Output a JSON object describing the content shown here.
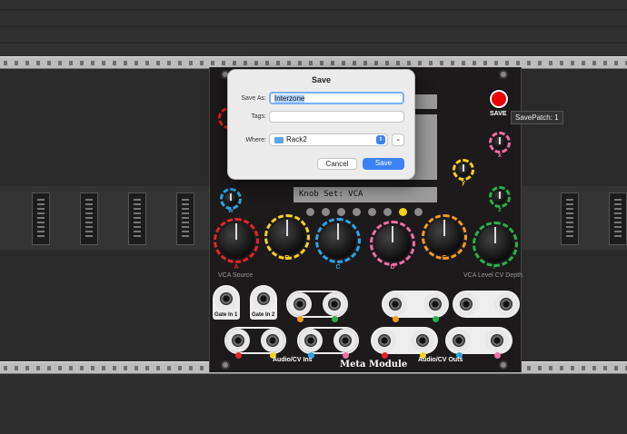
{
  "dialog": {
    "title": "Save",
    "save_as_label": "Save As:",
    "save_as_value": "Interzone",
    "tags_label": "Tags:",
    "tags_value": "",
    "where_label": "Where:",
    "where_value": "Rack2",
    "cancel_label": "Cancel",
    "save_label": "Save"
  },
  "module": {
    "save_button_label": "SAVE",
    "tooltip": "SavePatch: 1",
    "knob_set_display": "Knob Set:  VCA",
    "knobs": [
      {
        "label": "A",
        "color": "#e8232b"
      },
      {
        "label": "B",
        "color": "#f6d21a"
      },
      {
        "label": "C",
        "color": "#2aa7e2"
      },
      {
        "label": "D",
        "color": "#f06ea5"
      },
      {
        "label": "E",
        "color": "#f39b1e"
      },
      {
        "label": "F",
        "color": "#27b24a"
      }
    ],
    "small_knobs": [
      {
        "label": "x",
        "color": "#f06ea5"
      },
      {
        "label": "y",
        "color": "#f6d21a"
      },
      {
        "label": "z",
        "color": "#27b24a"
      },
      {
        "label": "w",
        "color": "#2aa7e2"
      },
      {
        "label": "",
        "color": "#e8232b"
      }
    ],
    "knob_a_caption": "VCA Source",
    "knob_f_caption": "VCA Level CV Depth",
    "gate_in_1": "Gate In 1",
    "gate_in_2": "Gate In 2",
    "audio_cv_ins": "Audio/CV Ins",
    "audio_cv_outs": "Audio/CV Outs",
    "brand": "Meta Module",
    "in_numbers": [
      "1",
      "2",
      "3",
      "4",
      "5",
      "6"
    ],
    "out_numbers": [
      "1",
      "2",
      "3",
      "4",
      "5",
      "6",
      "7",
      "8"
    ]
  },
  "colors": {
    "red": "#e8232b",
    "yellow": "#f6d21a",
    "blue": "#2aa7e2",
    "pink": "#f06ea5",
    "orange": "#f39b1e",
    "green": "#27b24a",
    "accent_button": "#3b82f6"
  }
}
